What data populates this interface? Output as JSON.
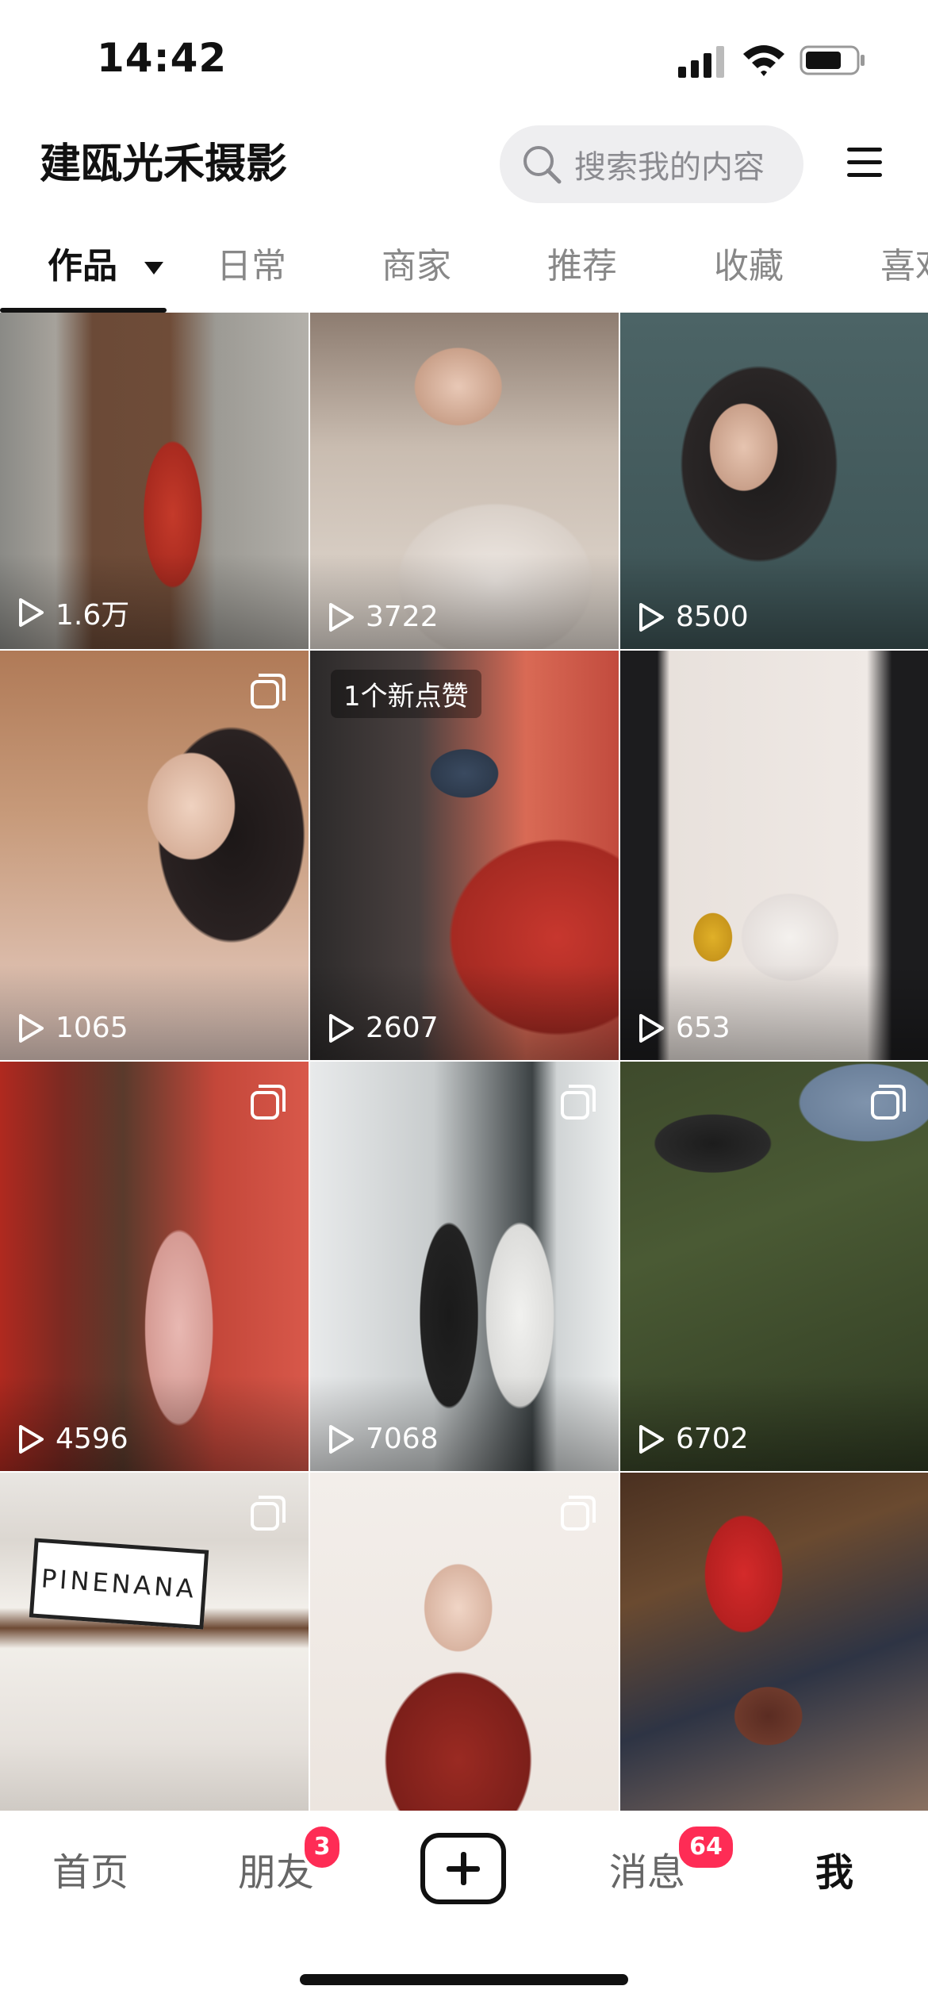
{
  "status_bar": {
    "time": "14:42",
    "icons": [
      "signal-icon",
      "wifi-icon",
      "battery-icon"
    ]
  },
  "header": {
    "account_name": "建瓯光禾摄影",
    "search_placeholder": "搜索我的内容",
    "menu_icon": "hamburger-menu-icon"
  },
  "tabs": [
    {
      "label": "作品",
      "active": true
    },
    {
      "label": "日常",
      "active": false
    },
    {
      "label": "商家",
      "active": false
    },
    {
      "label": "推荐",
      "active": false
    },
    {
      "label": "收藏",
      "active": false
    },
    {
      "label": "喜欢",
      "active": false
    }
  ],
  "grid": {
    "items": [
      {
        "plays": "1.6万",
        "multi": false,
        "new_like": ""
      },
      {
        "plays": "3722",
        "multi": false,
        "new_like": ""
      },
      {
        "plays": "8500",
        "multi": false,
        "new_like": ""
      },
      {
        "plays": "1065",
        "multi": true,
        "new_like": ""
      },
      {
        "plays": "2607",
        "multi": false,
        "new_like": "1个新点赞"
      },
      {
        "plays": "653",
        "multi": false,
        "new_like": ""
      },
      {
        "plays": "4596",
        "multi": true,
        "new_like": ""
      },
      {
        "plays": "7068",
        "multi": true,
        "new_like": ""
      },
      {
        "plays": "6702",
        "multi": true,
        "new_like": ""
      },
      {
        "plays": "",
        "multi": true,
        "new_like": ""
      },
      {
        "plays": "",
        "multi": true,
        "new_like": ""
      },
      {
        "plays": "",
        "multi": false,
        "new_like": ""
      }
    ],
    "sign_text": "PINENANA"
  },
  "bottom_nav": {
    "home": "首页",
    "friends": "朋友",
    "friends_badge": "3",
    "add_icon": "plus-square-icon",
    "messages": "消息",
    "messages_badge": "64",
    "me": "我"
  },
  "colors": {
    "accent": "#fe2c55",
    "text": "#111111",
    "muted": "#888888"
  }
}
